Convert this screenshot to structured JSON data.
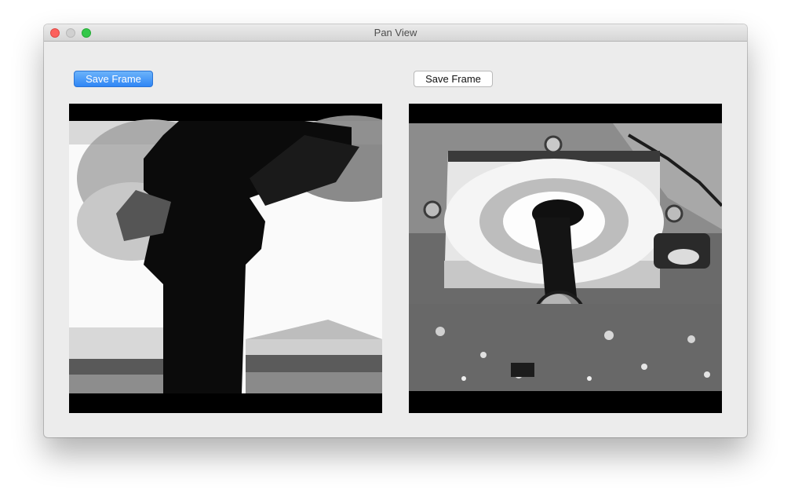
{
  "window": {
    "title": "Pan View"
  },
  "toolbar": {
    "left_save_label": "Save Frame",
    "right_save_label": "Save Frame"
  },
  "icons": {
    "close": "close-dot",
    "minimize": "minimize-dot",
    "zoom": "zoom-dot"
  },
  "colors": {
    "primary_button": "#2f86f5",
    "window_bg": "#ececec",
    "frame_bg": "#000000"
  }
}
